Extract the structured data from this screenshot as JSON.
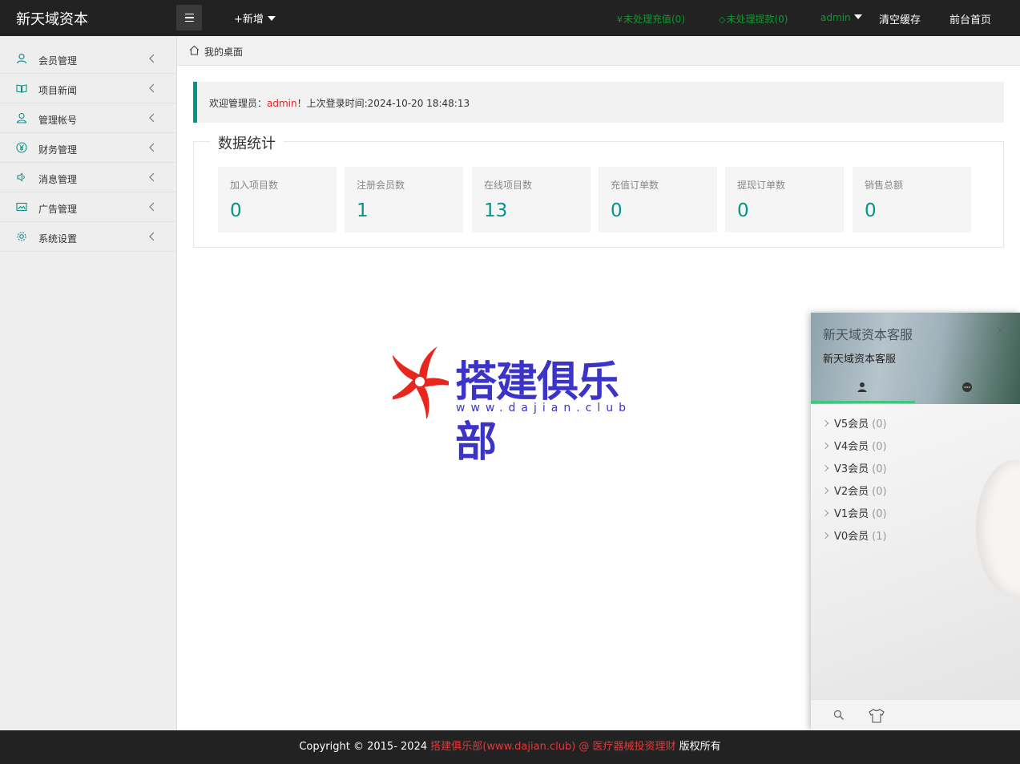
{
  "header": {
    "logo": "新天域资本",
    "add_new": "+新增",
    "pending_recharge": "未处理充值(0)",
    "pending_withdraw": "未处理提款(0)",
    "admin": "admin",
    "clear_cache": "清空缓存",
    "frontend_home": "前台首页"
  },
  "sidebar": {
    "items": [
      {
        "label": "会员管理",
        "icon": "user-icon"
      },
      {
        "label": "项目新闻",
        "icon": "book-icon"
      },
      {
        "label": "管理帐号",
        "icon": "user-outline-icon"
      },
      {
        "label": "财务管理",
        "icon": "yen-icon"
      },
      {
        "label": "消息管理",
        "icon": "speaker-icon"
      },
      {
        "label": "广告管理",
        "icon": "image-icon"
      },
      {
        "label": "系统设置",
        "icon": "gear-icon"
      }
    ]
  },
  "breadcrumb": {
    "current": "我的桌面"
  },
  "welcome": {
    "prefix": "欢迎管理员：",
    "user": "admin",
    "suffix": "！上次登录时间:2024-10-20 18:48:13"
  },
  "stats": {
    "legend": "数据统计",
    "cards": [
      {
        "label": "加入项目数",
        "value": "0"
      },
      {
        "label": "注册会员数",
        "value": "1"
      },
      {
        "label": "在线项目数",
        "value": "13"
      },
      {
        "label": "充值订单数",
        "value": "0"
      },
      {
        "label": "提现订单数",
        "value": "0"
      },
      {
        "label": "销售总额",
        "value": "0"
      }
    ]
  },
  "watermark": {
    "title": "搭建俱乐部",
    "url": "www.dajian.club"
  },
  "chat": {
    "title": "新天域资本客服",
    "subtitle": "新天域资本客服",
    "close": "×",
    "groups": [
      {
        "name": "V5会员",
        "count": "(0)"
      },
      {
        "name": "V4会员",
        "count": "(0)"
      },
      {
        "name": "V3会员",
        "count": "(0)"
      },
      {
        "name": "V2会员",
        "count": "(0)"
      },
      {
        "name": "V1会员",
        "count": "(0)"
      },
      {
        "name": "V0会员",
        "count": "(1)"
      }
    ]
  },
  "footer": {
    "prefix": "Copyright © 2015- 2024 ",
    "link": "搭建俱乐部(www.dajian.club) @ 医疗器械投资理财",
    "suffix": " 版权所有"
  },
  "colors": {
    "header_bg": "#222222",
    "accent": "#009688",
    "nav_green": "#0e9a2d",
    "brand_blue": "#3b34c7",
    "brand_red": "#e52222"
  }
}
